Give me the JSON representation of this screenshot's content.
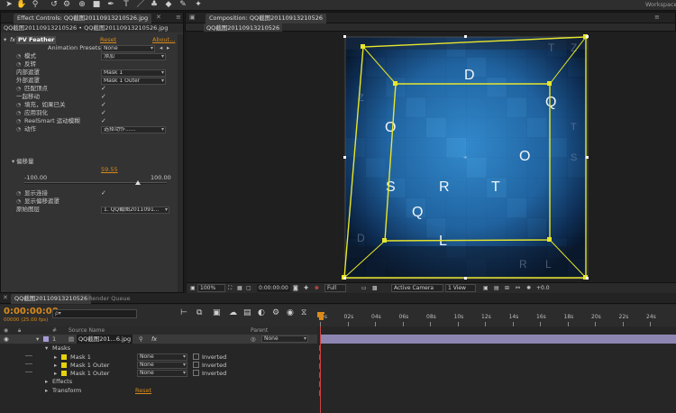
{
  "toolbar": {
    "workspace_label": "Workspace",
    "tool_icons": [
      "hand-tool",
      "zoom-tool",
      "rotate-tool",
      "camera-tool",
      "pan-behind-tool",
      "rectangle-tool",
      "pen-tool",
      "text-tool",
      "brush-tool",
      "clone-stamp-tool",
      "eraser-tool",
      "roto-brush-tool",
      "puppet-tool"
    ]
  },
  "effect_controls": {
    "tab_label": "Effect Controls: QQ截图20110913210526.jpg",
    "breadcrumb": "QQ截图20110913210526 • QQ截图20110913210526.jpg",
    "effect": {
      "fx": "fx",
      "name": "PV Feather",
      "reset": "Reset",
      "about": "About..."
    },
    "animation_presets": {
      "label": "Animation Presets:",
      "value": "None"
    },
    "properties": [
      {
        "label": "模式",
        "value": "添加",
        "kind": "dropdown",
        "stopwatch": true
      },
      {
        "label": "反转",
        "value": "",
        "kind": "checkbox",
        "checked": false,
        "stopwatch": true
      },
      {
        "label": "内部遮罩",
        "value": "Mask 1",
        "kind": "dropdown",
        "stopwatch": false
      },
      {
        "label": "外部遮罩",
        "value": "Mask 1 Outer",
        "kind": "dropdown",
        "stopwatch": false
      },
      {
        "label": "匹配顶点",
        "value": "✓",
        "kind": "checkbox",
        "checked": true,
        "stopwatch": true
      },
      {
        "label": "一起移动",
        "value": "✓",
        "kind": "checkbox",
        "checked": true,
        "stopwatch": false
      },
      {
        "label": "填充，如果已关",
        "value": "✓",
        "kind": "checkbox",
        "checked": true,
        "stopwatch": true
      },
      {
        "label": "应用羽化",
        "value": "✓",
        "kind": "checkbox",
        "checked": true,
        "stopwatch": true
      },
      {
        "label": "ReelSmart 运动模糊",
        "value": "✓",
        "kind": "checkbox",
        "checked": true,
        "stopwatch": true
      },
      {
        "label": "动作",
        "value": "选择动作......",
        "kind": "dropdown",
        "stopwatch": true
      }
    ],
    "offset": {
      "label": "偏移量",
      "value": "59.55",
      "min": "-100.00",
      "max": "100.00"
    },
    "extra": [
      {
        "label": "显示连接",
        "value": "✓",
        "stopwatch": true
      },
      {
        "label": "显示偏移遮罩",
        "value": "",
        "stopwatch": true
      }
    ],
    "source_layer": {
      "label": "原始图层",
      "value": "1. QQ截图2011091..."
    }
  },
  "composition": {
    "tab_label": "Composition: QQ截图20110913210526",
    "breadcrumb": "QQ截图20110913210526",
    "letters": [
      {
        "ch": "D",
        "dim": false
      },
      {
        "ch": "Q",
        "dim": false
      },
      {
        "ch": "O",
        "dim": false
      },
      {
        "ch": "O",
        "dim": false
      },
      {
        "ch": "S",
        "dim": false
      },
      {
        "ch": "R",
        "dim": false
      },
      {
        "ch": "T",
        "dim": false
      },
      {
        "ch": "Q",
        "dim": false
      },
      {
        "ch": "L",
        "dim": false
      },
      {
        "ch": "T",
        "dim": true
      },
      {
        "ch": "Z",
        "dim": true
      },
      {
        "ch": "Z",
        "dim": true
      },
      {
        "ch": "T",
        "dim": true
      },
      {
        "ch": "S",
        "dim": true
      },
      {
        "ch": "D",
        "dim": true
      },
      {
        "ch": "R",
        "dim": true
      },
      {
        "ch": "L",
        "dim": true
      }
    ],
    "footer": {
      "zoom": "100%",
      "timecode": "0:00:00:00",
      "resolution": "Full",
      "camera": "Active Camera",
      "view": "1 View",
      "exposure": "+0.0"
    },
    "colors": {
      "mask": "#e8e62a",
      "tile_light": "#4aa4e0",
      "tile_dark": "#0a1a33"
    }
  },
  "timeline": {
    "tab_label": "QQ截图20110913210526",
    "render_queue_label": "Render Queue",
    "timecode": "0:00:00:00",
    "fps": "00000 (25.00 fps)",
    "search_placeholder": "ρ▾",
    "columns": {
      "num": "#",
      "source_name": "Source Name",
      "parent": "Parent"
    },
    "layer": {
      "index": "1",
      "name": "QQ截图201...6.jpg",
      "parent": "None"
    },
    "masks_label": "Masks",
    "masks": [
      {
        "name": "Mask 1",
        "mode": "None",
        "inverted": "Inverted"
      },
      {
        "name": "Mask 1 Outer",
        "mode": "None",
        "inverted": "Inverted"
      },
      {
        "name": "Mask 1 Outer",
        "mode": "None",
        "inverted": "Inverted"
      }
    ],
    "effects_label": "Effects",
    "transform_label": "Transform",
    "transform_reset": "Reset",
    "ruler": [
      "0s",
      "02s",
      "04s",
      "06s",
      "08s",
      "10s",
      "12s",
      "14s",
      "16s",
      "18s",
      "20s",
      "22s",
      "24s"
    ]
  }
}
